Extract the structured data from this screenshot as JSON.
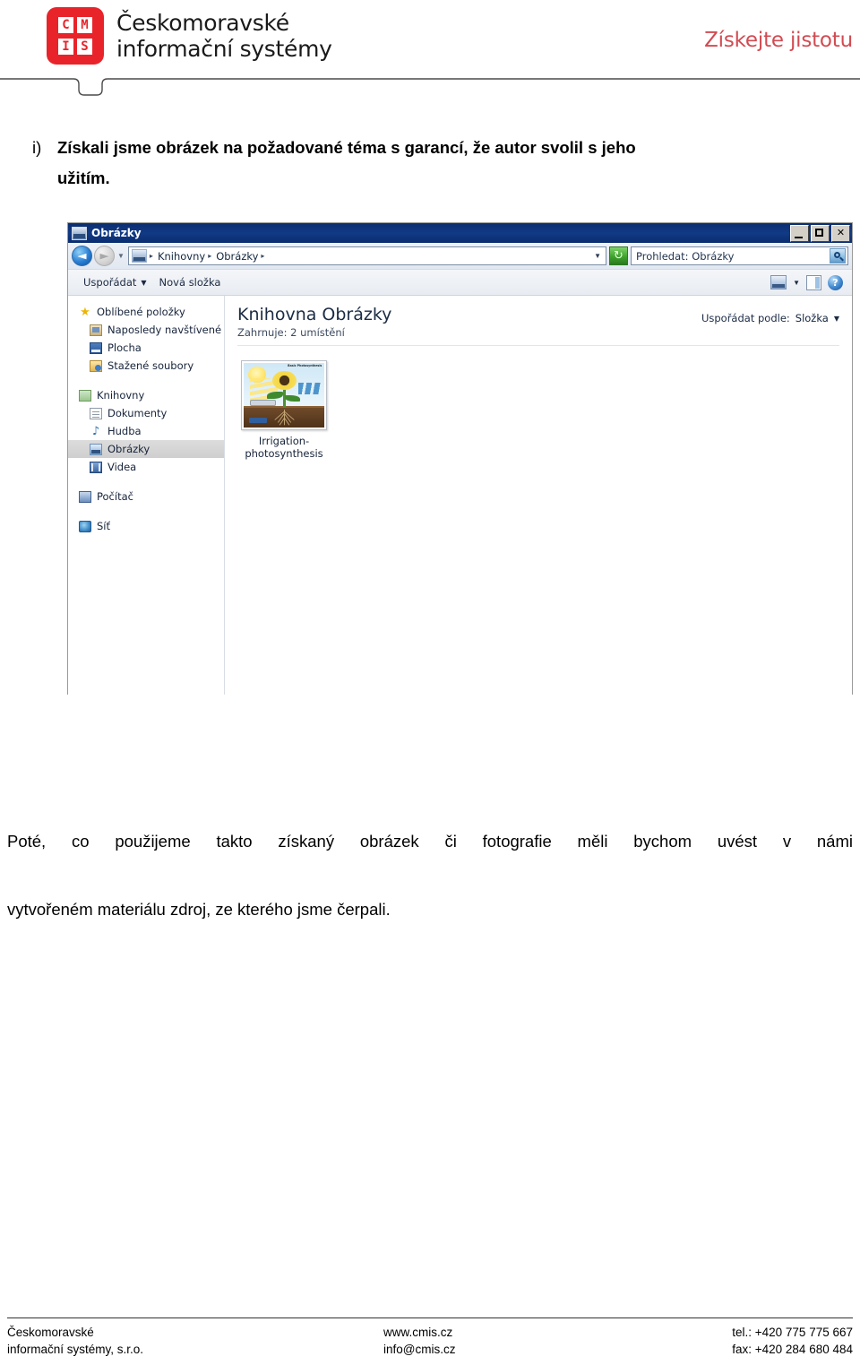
{
  "header": {
    "logo": {
      "mark_top": [
        "C",
        "M"
      ],
      "mark_bottom": [
        "I",
        "S"
      ],
      "name_line1": "Českomoravské",
      "name_line2": "informační systémy",
      "color": "#e8242a"
    },
    "tagline": "Získejte jistotu",
    "tagline_color": "#d24b52"
  },
  "content": {
    "list_marker": "i)",
    "heading_line1": "Získali jsme obrázek na požadované téma s garancí, že autor svolil s jeho",
    "heading_line2": "užitím.",
    "paragraph_line1": "Poté, co použijeme takto získaný obrázek či fotografie měli bychom uvést v námi",
    "paragraph_line2": "vytvořeném materiálu zdroj, ze kterého jsme čerpali."
  },
  "explorer": {
    "title": "Obrázky",
    "title_icon": "pictures-library-icon",
    "window_buttons": {
      "minimize": "minimize-icon",
      "maximize": "maximize-icon",
      "close": "✕"
    },
    "navigation": {
      "back_arrow": "◄",
      "forward_arrow": "►",
      "history_caret": "▼",
      "address_icon": "pictures-library-icon",
      "breadcrumbs": [
        "Knihovny",
        "Obrázky"
      ],
      "breadcrumb_separator": "▸",
      "address_caret": "▼",
      "refresh_glyph": "↻"
    },
    "search": {
      "value": "Prohledat: Obrázky",
      "placeholder": "Prohledat: Obrázky",
      "icon": "search-icon"
    },
    "toolbar": {
      "organize_label": "Uspořádat",
      "organize_caret": "▼",
      "new_folder_label": "Nová složka",
      "view_icon": "view-icon",
      "view_caret": "▼",
      "preview_pane_icon": "preview-pane-icon",
      "help_icon": "?"
    },
    "sidebar": {
      "groups": [
        {
          "header": {
            "label": "Oblíbené položky",
            "icon": "star-icon"
          },
          "items": [
            {
              "label": "Naposledy navštívené",
              "icon": "recent-places-icon",
              "selected": false
            },
            {
              "label": "Plocha",
              "icon": "desktop-icon",
              "selected": false
            },
            {
              "label": "Stažené soubory",
              "icon": "downloads-icon",
              "selected": false
            }
          ]
        },
        {
          "header": {
            "label": "Knihovny",
            "icon": "libraries-icon"
          },
          "items": [
            {
              "label": "Dokumenty",
              "icon": "documents-icon",
              "selected": false
            },
            {
              "label": "Hudba",
              "icon": "music-icon",
              "selected": false
            },
            {
              "label": "Obrázky",
              "icon": "pictures-icon",
              "selected": true
            },
            {
              "label": "Videa",
              "icon": "videos-icon",
              "selected": false
            }
          ]
        },
        {
          "header": {
            "label": "Počítač",
            "icon": "computer-icon"
          },
          "items": []
        },
        {
          "header": {
            "label": "Síť",
            "icon": "network-icon"
          },
          "items": []
        }
      ]
    },
    "library": {
      "title": "Knihovna Obrázky",
      "subtitle": "Zahrnuje: 2 umístění",
      "arrange_label": "Uspořádat podle:",
      "arrange_value": "Složka",
      "arrange_caret": "▼"
    },
    "files": [
      {
        "name": "Irrigation-photosynthesis",
        "thumbnail_label": "Basic Photosynthesis",
        "thumbnail_alt": "photosynthesis-diagram-thumbnail"
      }
    ]
  },
  "footer": {
    "company_line1": "Českomoravské",
    "company_line2": "informační systémy, s.r.o.",
    "web": "www.cmis.cz",
    "email": "info@cmis.cz",
    "phone": "tel.: +420 775 775 667",
    "fax": "fax: +420 284 680 484"
  }
}
